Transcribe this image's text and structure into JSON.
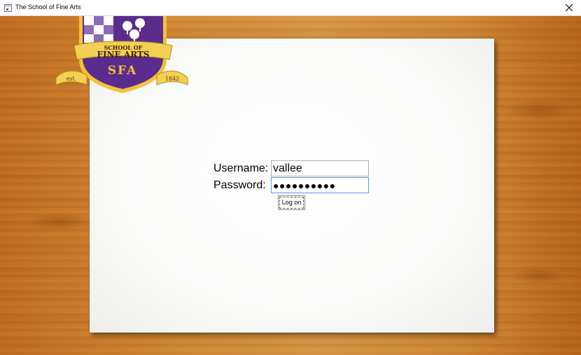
{
  "window": {
    "title": "The School of Fine Arts",
    "app_icon": "window-app-icon",
    "close_icon": "close-icon"
  },
  "crest": {
    "line1": "SCHOOL OF",
    "line2": "FINE ARTS",
    "initials": "SFA",
    "est_label": "est.",
    "year": "1842",
    "colors": {
      "purple": "#5b2c8e",
      "gold": "#f2c23a",
      "ribbon": "#f3cf52"
    }
  },
  "login": {
    "username_label": "Username:",
    "username_value": "vallee",
    "password_label": "Password:",
    "password_value": "●●●●●●●●●●",
    "logon_label": "Log on"
  }
}
